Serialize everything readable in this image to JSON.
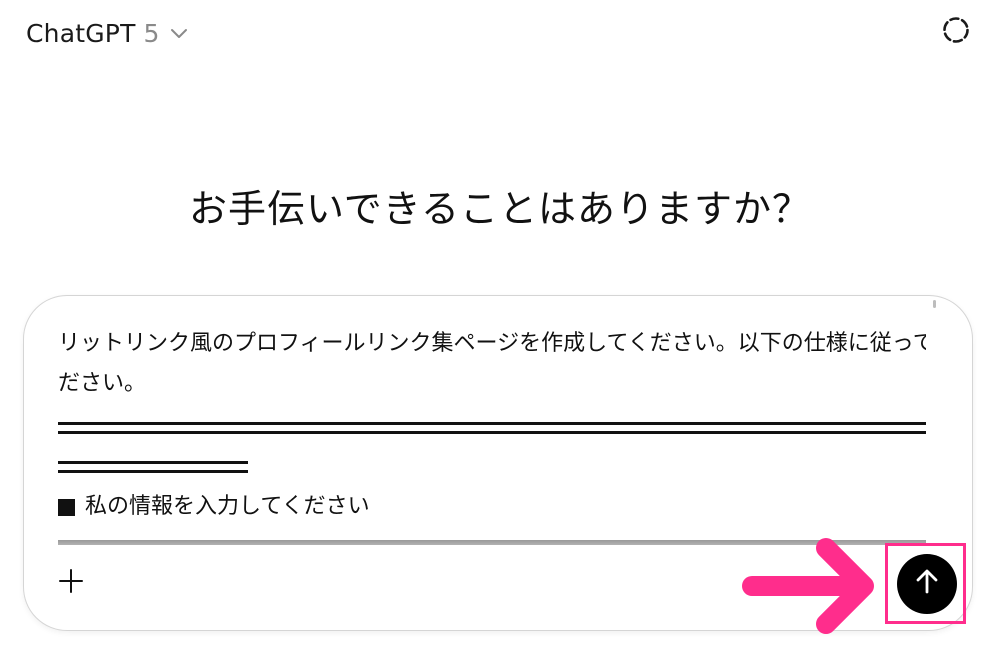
{
  "header": {
    "model_name": "ChatGPT",
    "model_version": "5",
    "model_menu_icon": "chevron-down-icon",
    "temporary_chat_icon": "dashed-circle-icon"
  },
  "main": {
    "heading": "お手伝いできることはありますか？"
  },
  "composer": {
    "prompt_line1": "リットリンク風のプロフィールリンク集ページを作成してください。以下の仕様に従ってく",
    "prompt_line2": "ださい。",
    "section_label": "私の情報を入力してください",
    "bullet_icon": "black-square",
    "plus_icon": "plus-icon",
    "send_icon": "arrow-up-icon"
  },
  "annotation": {
    "highlight_color": "#ff2d8c",
    "pointer_icon": "right-arrow-icon"
  },
  "colors": {
    "send_button": "#000000",
    "accent_pink": "#ff2d8c",
    "muted_text": "#8a8a8a"
  }
}
